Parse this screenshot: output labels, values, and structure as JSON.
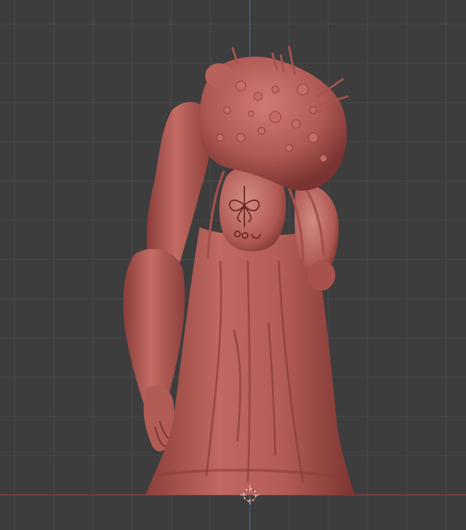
{
  "viewport": {
    "background": "#3d3d3d",
    "grid_color": "#4a4a4a",
    "grid_major_color": "#505050",
    "axis_x_color": "#a03a44",
    "axis_z_color": "#3f6fb3",
    "cursor_color": "#e6e6e6",
    "cursor_accent": "#c0392b"
  },
  "model": {
    "base_color": "#b05a55",
    "shadow_color": "#7a3330",
    "highlight_color": "#cf7a72"
  }
}
